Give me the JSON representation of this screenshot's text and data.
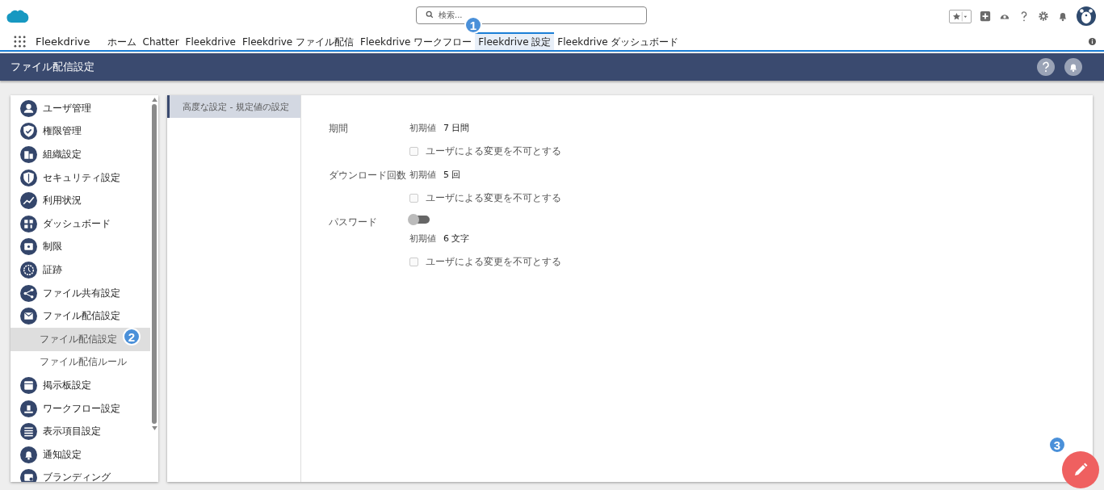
{
  "header": {
    "search": {
      "placeholder": "検索..."
    }
  },
  "nav": {
    "app_name": "Fleekdrive",
    "tabs": [
      {
        "label": "ホーム",
        "selected": false
      },
      {
        "label": "Chatter",
        "selected": false
      },
      {
        "label": "Fleekdrive",
        "selected": false
      },
      {
        "label": "Fleekdrive ファイル配信",
        "selected": false
      },
      {
        "label": "Fleekdrive ワークフロー",
        "selected": false
      },
      {
        "label": "Fleekdrive 設定",
        "selected": true
      },
      {
        "label": "Fleekdrive ダッシュボード",
        "selected": false
      }
    ]
  },
  "page_title": "ファイル配信設定",
  "sidebar": {
    "items": [
      {
        "kind": "main",
        "label": "ユーザ管理",
        "selected": false
      },
      {
        "kind": "main",
        "label": "権限管理",
        "selected": false
      },
      {
        "kind": "main",
        "label": "組織設定",
        "selected": false
      },
      {
        "kind": "main",
        "label": "セキュリティ設定",
        "selected": false
      },
      {
        "kind": "main",
        "label": "利用状況",
        "selected": false
      },
      {
        "kind": "main",
        "label": "ダッシュボード",
        "selected": false
      },
      {
        "kind": "main",
        "label": "制限",
        "selected": false
      },
      {
        "kind": "main",
        "label": "証跡",
        "selected": false
      },
      {
        "kind": "main",
        "label": "ファイル共有設定",
        "selected": false
      },
      {
        "kind": "main",
        "label": "ファイル配信設定",
        "selected": false
      },
      {
        "kind": "sub",
        "label": "ファイル配信設定",
        "selected": true
      },
      {
        "kind": "sub",
        "label": "ファイル配信ルール",
        "selected": false
      },
      {
        "kind": "main",
        "label": "掲示板設定",
        "selected": false
      },
      {
        "kind": "main",
        "label": "ワークフロー設定",
        "selected": false
      },
      {
        "kind": "main",
        "label": "表示項目設定",
        "selected": false
      },
      {
        "kind": "main",
        "label": "通知設定",
        "selected": false
      },
      {
        "kind": "main",
        "label": "ブランディング",
        "selected": false
      }
    ]
  },
  "section_nav": [
    {
      "label": "高度な設定 - 規定値の設定",
      "selected": true
    }
  ],
  "settings": [
    {
      "label": "期間",
      "default_label": "初期値",
      "default_value": "7 日間",
      "lock": {
        "label": "ユーザによる変更を不可とする",
        "checked": false
      }
    },
    {
      "label": "ダウンロード回数",
      "default_label": "初期値",
      "default_value": "5 回",
      "lock": {
        "label": "ユーザによる変更を不可とする",
        "checked": false
      }
    },
    {
      "label": "パスワード",
      "toggle": {
        "on": false
      },
      "default_label": "初期値",
      "default_value": "6 文字",
      "lock": {
        "label": "ユーザによる変更を不可とする",
        "checked": false
      }
    }
  ],
  "callouts": [
    "1",
    "2",
    "3"
  ]
}
